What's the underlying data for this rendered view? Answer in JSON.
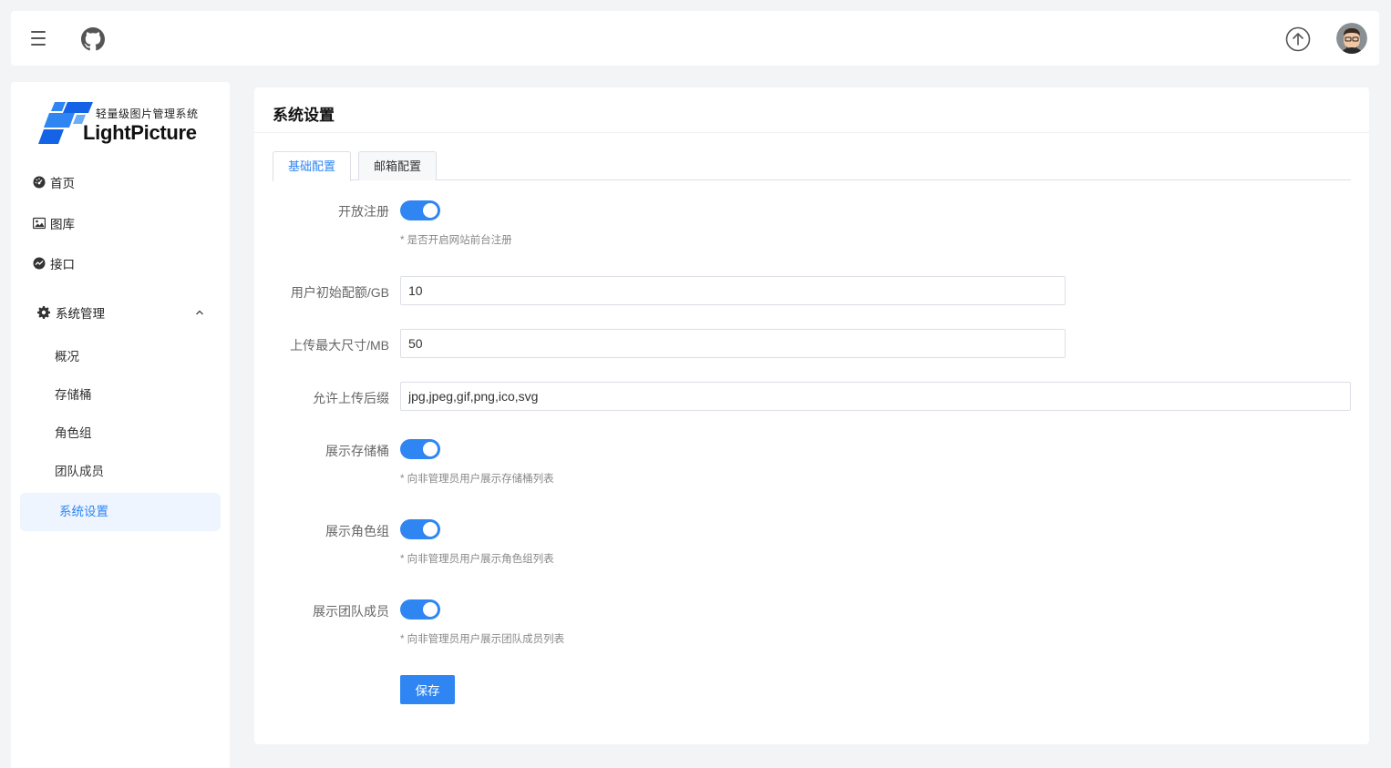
{
  "header": {
    "menu_icon": "hamburger-icon",
    "github_icon": "github-icon",
    "upload_icon": "upload-icon",
    "avatar": "user-avatar"
  },
  "sidebar": {
    "logo": {
      "subtitle": "轻量级图片管理系统",
      "name": "LightPicture"
    },
    "items": [
      {
        "label": "首页",
        "icon": "dashboard-icon"
      },
      {
        "label": "图库",
        "icon": "image-icon"
      },
      {
        "label": "接口",
        "icon": "api-icon"
      }
    ],
    "group": {
      "label": "系统管理",
      "icon": "gear-icon",
      "expanded": true,
      "children": [
        {
          "label": "概况"
        },
        {
          "label": "存储桶"
        },
        {
          "label": "角色组"
        },
        {
          "label": "团队成员"
        },
        {
          "label": "系统设置",
          "active": true
        }
      ]
    }
  },
  "main": {
    "title": "系统设置",
    "tabs": [
      {
        "label": "基础配置",
        "active": true
      },
      {
        "label": "邮箱配置",
        "active": false
      }
    ],
    "form": {
      "open_register": {
        "label": "开放注册",
        "on": true,
        "hint": "* 是否开启网站前台注册"
      },
      "init_quota": {
        "label": "用户初始配额/GB",
        "value": "10"
      },
      "max_upload": {
        "label": "上传最大尺寸/MB",
        "value": "50"
      },
      "allowed_ext": {
        "label": "允许上传后缀",
        "value": "jpg,jpeg,gif,png,ico,svg"
      },
      "show_bucket": {
        "label": "展示存储桶",
        "on": true,
        "hint": "* 向非管理员用户展示存储桶列表"
      },
      "show_role": {
        "label": "展示角色组",
        "on": true,
        "hint": "* 向非管理员用户展示角色组列表"
      },
      "show_team": {
        "label": "展示团队成员",
        "on": true,
        "hint": "* 向非管理员用户展示团队成员列表"
      },
      "save_label": "保存"
    }
  },
  "colors": {
    "primary": "#2f86f2",
    "background": "#f3f4f6"
  }
}
